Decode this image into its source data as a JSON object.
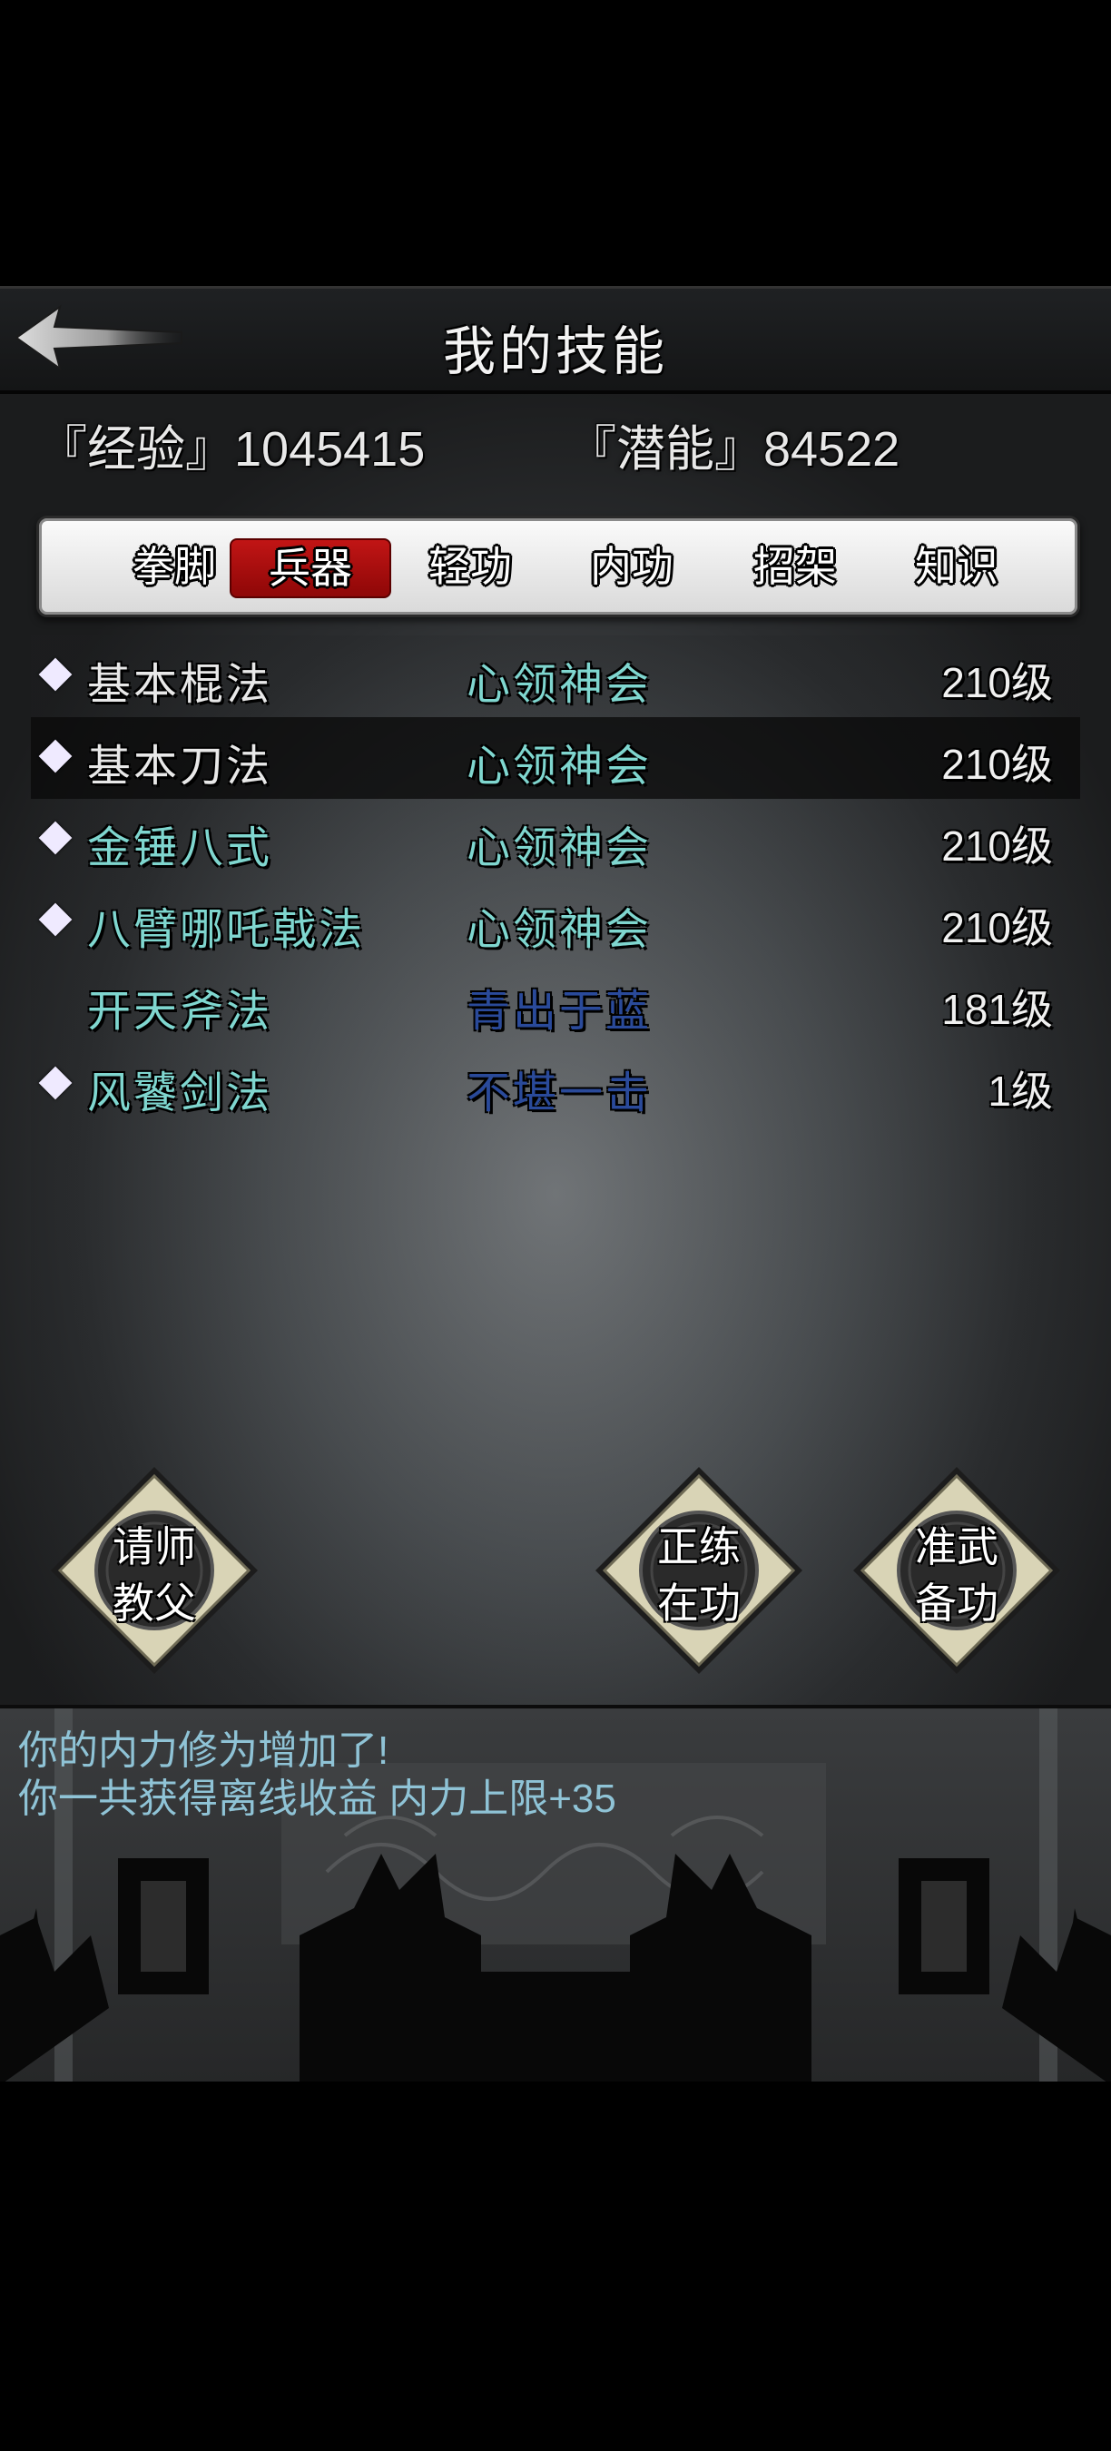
{
  "header": {
    "title": "我的技能",
    "back_icon": "back-arrow-icon"
  },
  "stats": {
    "experience": "『经验』1045415",
    "potential": "『潜能』84522"
  },
  "tabs": [
    {
      "label": "拳脚",
      "active": false
    },
    {
      "label": "兵器",
      "active": true
    },
    {
      "label": "轻功",
      "active": false
    },
    {
      "label": "内功",
      "active": false
    },
    {
      "label": "招架",
      "active": false
    },
    {
      "label": "知识",
      "active": false
    }
  ],
  "skills": [
    {
      "name": "基本棍法",
      "level": "心领神会",
      "grade": "210级",
      "marked": true,
      "name_color": "#e8e8e8",
      "level_color": "#7fd6cf",
      "selected": false
    },
    {
      "name": "基本刀法",
      "level": "心领神会",
      "grade": "210级",
      "marked": true,
      "name_color": "#e8e8e8",
      "level_color": "#7fd6cf",
      "selected": true
    },
    {
      "name": "金锤八式",
      "level": "心领神会",
      "grade": "210级",
      "marked": true,
      "name_color": "#7fd6cf",
      "level_color": "#7fd6cf",
      "selected": false
    },
    {
      "name": "八臂哪吒戟法",
      "level": "心领神会",
      "grade": "210级",
      "marked": true,
      "name_color": "#7fd6cf",
      "level_color": "#7fd6cf",
      "selected": false
    },
    {
      "name": "开天斧法",
      "level": "青出于蓝",
      "grade": "181级",
      "marked": false,
      "name_color": "#7fd6cf",
      "level_color": "#2a4a9a",
      "selected": false
    },
    {
      "name": "风饕剑法",
      "level": "不堪一击",
      "grade": "1级",
      "marked": true,
      "name_color": "#7fd6cf",
      "level_color": "#2a4a9a",
      "selected": false
    }
  ],
  "buttons": {
    "ask_master": {
      "line1": "请师",
      "line2": "教父"
    },
    "practice": {
      "line1": "正练",
      "line2": "在功"
    },
    "prepare": {
      "line1": "准武",
      "line2": "备功"
    }
  },
  "messages": [
    "你的内力修为增加了!",
    "你一共获得离线收益 内力上限+35"
  ],
  "colors": {
    "active_tab": "#b00f0f",
    "skill_cyan": "#7fd6cf",
    "skill_blue": "#2a4a9a",
    "message_text": "#8fc3d6"
  }
}
